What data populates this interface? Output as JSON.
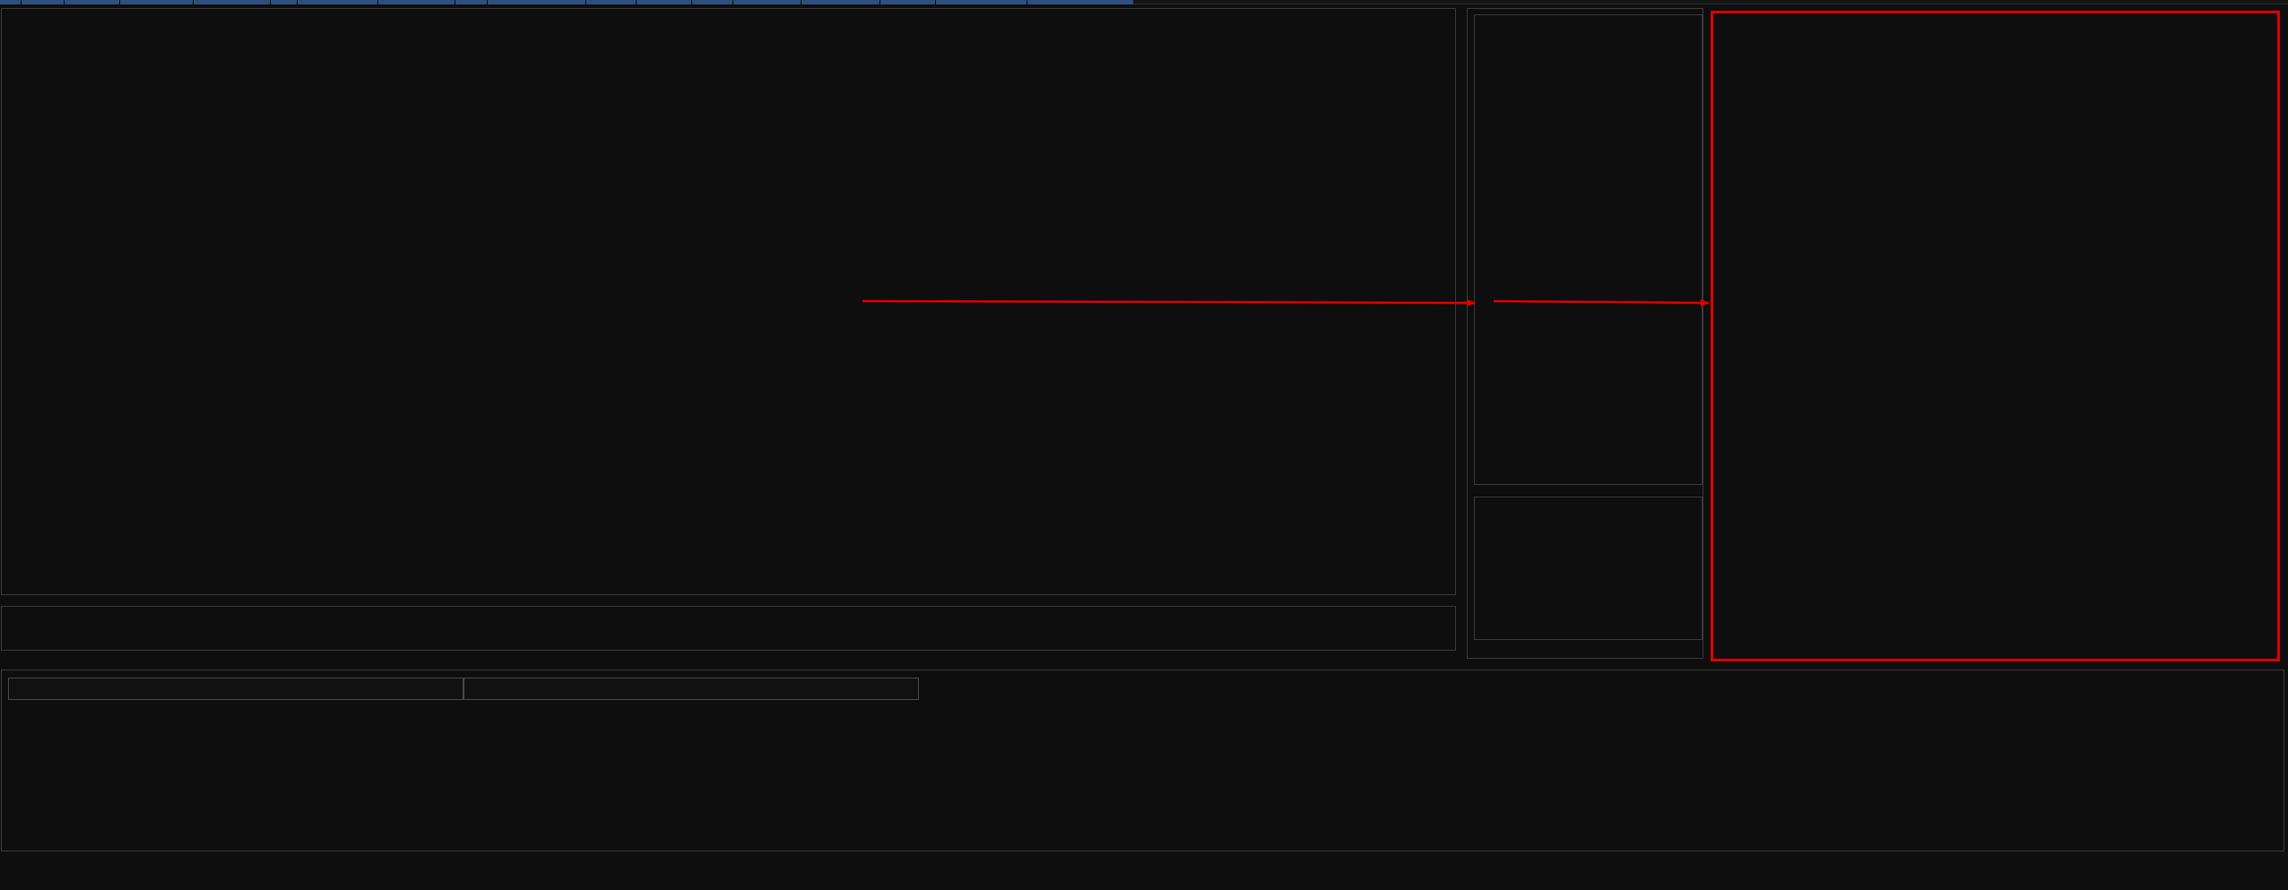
{
  "window": {
    "background": "#0e0e0e",
    "border_color": "#3a3a3a"
  },
  "menubar": {
    "active_color": "#2f4f7f",
    "items": [
      "",
      "",
      "",
      "",
      "",
      "",
      "",
      "",
      "",
      "",
      "",
      "",
      "",
      "",
      "",
      "",
      ""
    ]
  },
  "annotation": {
    "highlight_color": "#e00000",
    "arrows": [
      "arrow-into-middle-panel",
      "arrow-into-right-panel"
    ]
  },
  "bottom_panel": {
    "tabs": [
      {
        "label": ""
      },
      {
        "label": ""
      }
    ]
  }
}
